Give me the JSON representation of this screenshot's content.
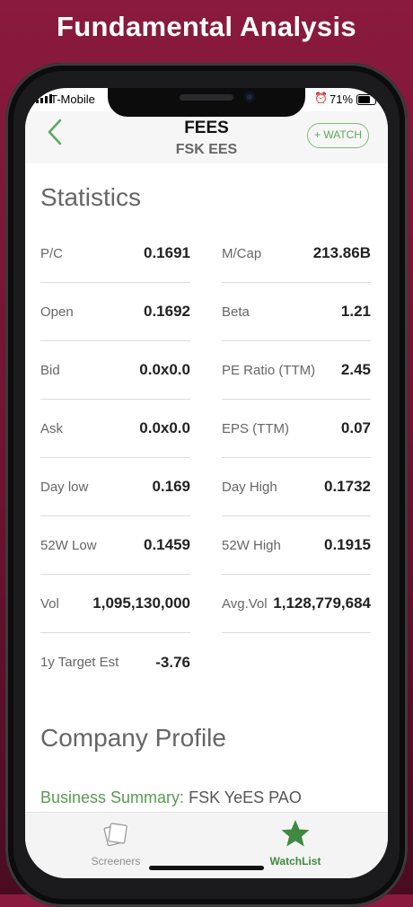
{
  "promo": {
    "title": "Fundamental Analysis"
  },
  "status_bar": {
    "carrier": "T-Mobile",
    "battery": "71%",
    "alarm_icon": "alarm-clock-icon"
  },
  "nav": {
    "title": "FEES",
    "subtitle": "FSK EES",
    "watch_label": "+ WATCH",
    "back_icon": "chevron-left-icon"
  },
  "statistics": {
    "heading": "Statistics",
    "left": [
      {
        "label": "P/C",
        "value": "0.1691"
      },
      {
        "label": "Open",
        "value": "0.1692"
      },
      {
        "label": "Bid",
        "value": "0.0x0.0"
      },
      {
        "label": "Ask",
        "value": "0.0x0.0"
      },
      {
        "label": "Day low",
        "value": "0.169"
      },
      {
        "label": "52W Low",
        "value": "0.1459"
      },
      {
        "label": "Vol",
        "value": "1,095,130,000"
      },
      {
        "label": "1y Target Est",
        "value": "-3.76"
      }
    ],
    "right": [
      {
        "label": "M/Cap",
        "value": "213.86B"
      },
      {
        "label": "Beta",
        "value": "1.21"
      },
      {
        "label": "PE Ratio (TTM)",
        "value": "2.45"
      },
      {
        "label": "EPS (TTM)",
        "value": "0.07"
      },
      {
        "label": "Day High",
        "value": "0.1732"
      },
      {
        "label": "52W High",
        "value": "0.1915"
      },
      {
        "label": "Avg.Vol",
        "value": "1,128,779,684"
      }
    ]
  },
  "company_profile": {
    "heading": "Company Profile",
    "business_label": "Business Summary:",
    "business_value": "FSK YeES PAO"
  },
  "tabs": [
    {
      "label": "Screeners",
      "icon": "screeners-cards-icon",
      "active": false
    },
    {
      "label": "WatchList",
      "icon": "star-icon",
      "active": true
    }
  ],
  "colors": {
    "brand_background": "#7a1535",
    "accent_green": "#5a9a52",
    "tab_active": "#3f8a3f"
  }
}
